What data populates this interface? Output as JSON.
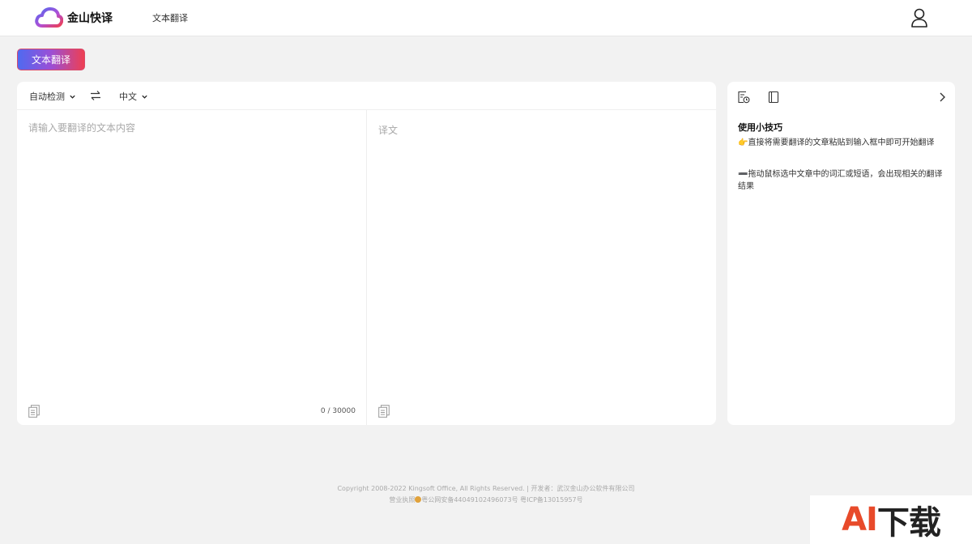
{
  "header": {
    "logo_text": "金山快译",
    "nav": [
      {
        "label": "文本翻译"
      }
    ],
    "icons": {
      "logo": "cloud-logo-icon",
      "user": "user-icon"
    }
  },
  "mode_tab": {
    "label": "文本翻译",
    "gradient": [
      "#4f6af0",
      "#9b4fd6",
      "#ee3f52"
    ]
  },
  "translator": {
    "source_lang": "自动检测",
    "target_lang": "中文",
    "input": {
      "value": "",
      "placeholder": "请输入要翻译的文本内容"
    },
    "output_placeholder": "译文",
    "char_count": "0 / 30000",
    "icons": {
      "swap": "swap-arrows-icon",
      "copy": "copy-icon",
      "dropdown": "chevron-down-icon"
    }
  },
  "tips": {
    "title": "使用小技巧",
    "items": [
      {
        "emoji": "👉",
        "text": "直接将需要翻译的文章粘贴到输入框中即可开始翻译"
      },
      {
        "emoji": "➖",
        "text": "拖动鼠标选中文章中的词汇或短语，会出现相关的翻译结果"
      }
    ],
    "icons": {
      "history": "history-icon",
      "book": "book-icon",
      "collapse": "chevron-right-icon"
    }
  },
  "footer": {
    "line1": "Copyright 2008-2022 Kingsoft Office, All Rights Reserved. | 开发者：武汉金山办公软件有限公司",
    "line2_prefix": "营业执照",
    "line2_rest": "粤公网安备44049102496073号 粤ICP备13015957号"
  },
  "watermark": {
    "ai": "AI",
    "rest": "下载"
  }
}
